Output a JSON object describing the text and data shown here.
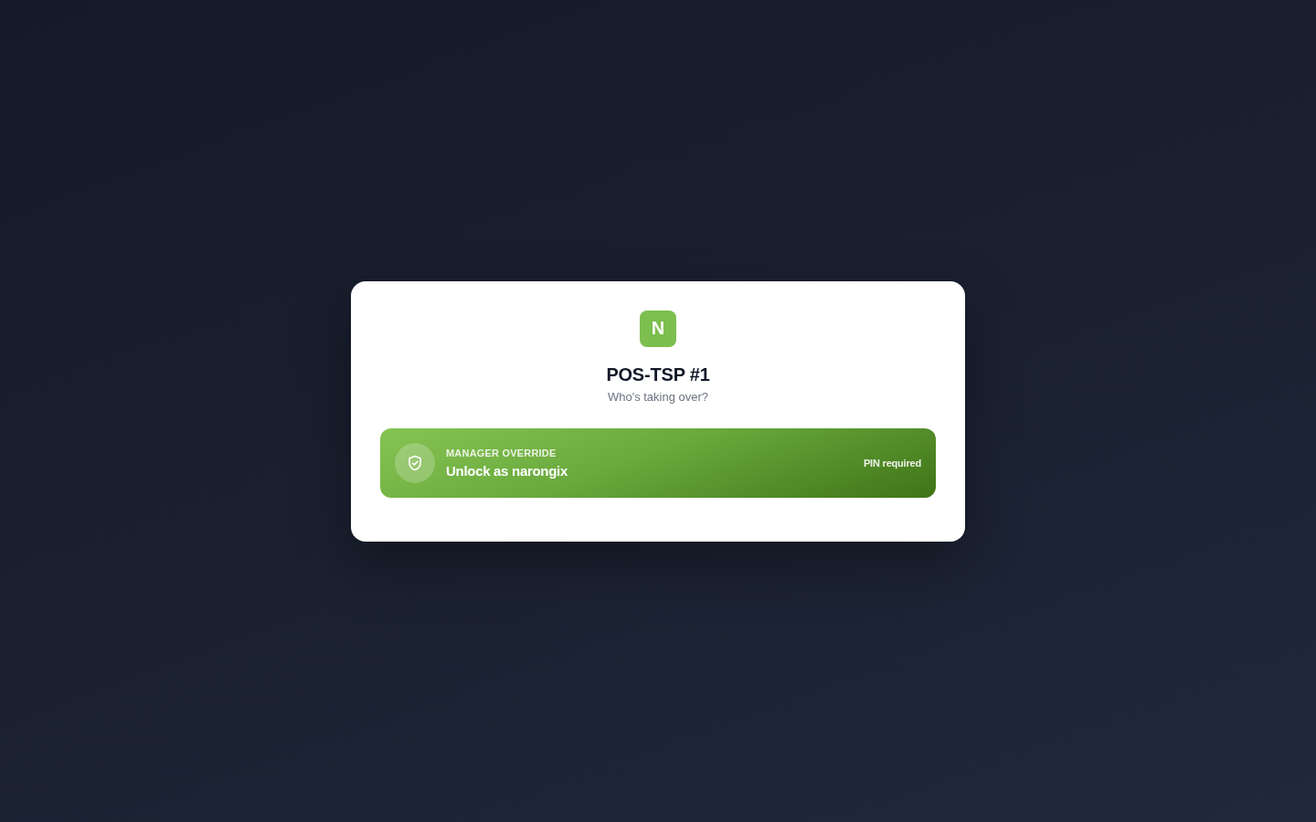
{
  "logo": {
    "letter": "N"
  },
  "title": "POS-TSP #1",
  "subtitle": "Who's taking over?",
  "override": {
    "eyebrow": "MANAGER OVERRIDE",
    "label": "Unlock as narongix",
    "hint": "PIN required"
  }
}
